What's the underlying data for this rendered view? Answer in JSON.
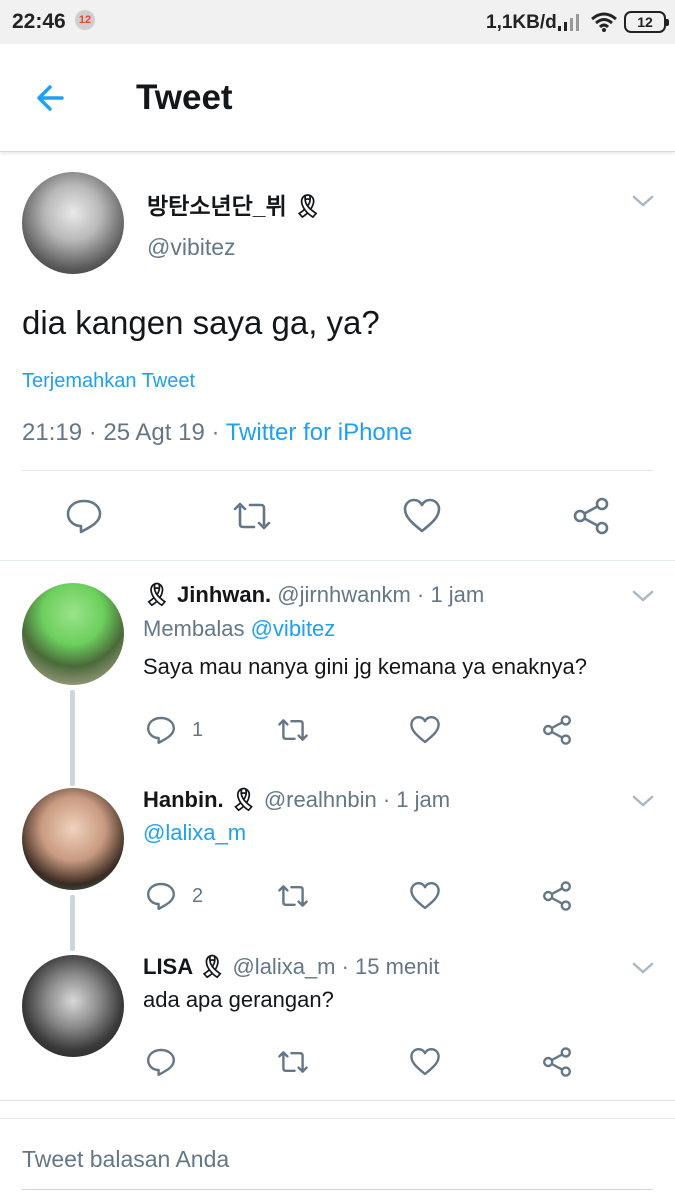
{
  "status_bar": {
    "time": "22:46",
    "notification_badge": "12",
    "net_speed": "1,1KB/d",
    "battery": "12"
  },
  "header": {
    "title": "Tweet"
  },
  "tweet": {
    "display_name": "방탄소년단_뷔 🎗",
    "handle": "@vibitez",
    "text": "dia kangen saya ga, ya?",
    "translate_label": "Terjemahkan Tweet",
    "timestamp": "21:19 · 25 Agt 19 · ",
    "source": "Twitter for iPhone"
  },
  "replies": [
    {
      "display_name": "🎗 Jinhwan.",
      "handle": "@jirnhwankm",
      "time": " · 1 jam",
      "replying_prefix": "Membalas ",
      "replying_to": "@vibitez",
      "text": "Saya mau nanya gini jg kemana ya enaknya?",
      "reply_count": "1"
    },
    {
      "display_name": "Hanbin. 🎗",
      "handle": "@realhnbin",
      "time": " · 1 jam",
      "text": "@lalixa_m",
      "reply_count": "2"
    },
    {
      "display_name": "LISA 🎗",
      "handle": "@lalixa_m",
      "time": " · 15 menit",
      "text": "ada apa gerangan?"
    }
  ],
  "reply_box": {
    "placeholder": "Tweet balasan Anda"
  },
  "colors": {
    "accent": "#1da1f2",
    "text_primary": "#14171a",
    "text_secondary": "#657786",
    "divider": "#e1e8ed"
  },
  "icons": [
    "back-arrow-icon",
    "chevron-down-icon",
    "reply-icon",
    "retweet-icon",
    "like-icon",
    "share-icon"
  ]
}
